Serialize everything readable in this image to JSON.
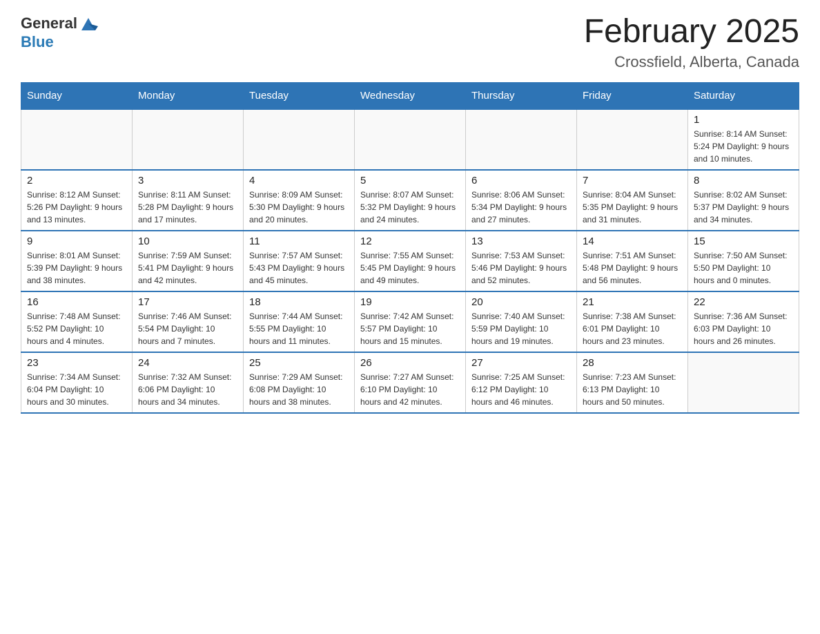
{
  "header": {
    "logo_general": "General",
    "logo_blue": "Blue",
    "month_title": "February 2025",
    "location": "Crossfield, Alberta, Canada"
  },
  "days_of_week": [
    "Sunday",
    "Monday",
    "Tuesday",
    "Wednesday",
    "Thursday",
    "Friday",
    "Saturday"
  ],
  "weeks": [
    [
      {
        "day": "",
        "info": ""
      },
      {
        "day": "",
        "info": ""
      },
      {
        "day": "",
        "info": ""
      },
      {
        "day": "",
        "info": ""
      },
      {
        "day": "",
        "info": ""
      },
      {
        "day": "",
        "info": ""
      },
      {
        "day": "1",
        "info": "Sunrise: 8:14 AM\nSunset: 5:24 PM\nDaylight: 9 hours and 10 minutes."
      }
    ],
    [
      {
        "day": "2",
        "info": "Sunrise: 8:12 AM\nSunset: 5:26 PM\nDaylight: 9 hours and 13 minutes."
      },
      {
        "day": "3",
        "info": "Sunrise: 8:11 AM\nSunset: 5:28 PM\nDaylight: 9 hours and 17 minutes."
      },
      {
        "day": "4",
        "info": "Sunrise: 8:09 AM\nSunset: 5:30 PM\nDaylight: 9 hours and 20 minutes."
      },
      {
        "day": "5",
        "info": "Sunrise: 8:07 AM\nSunset: 5:32 PM\nDaylight: 9 hours and 24 minutes."
      },
      {
        "day": "6",
        "info": "Sunrise: 8:06 AM\nSunset: 5:34 PM\nDaylight: 9 hours and 27 minutes."
      },
      {
        "day": "7",
        "info": "Sunrise: 8:04 AM\nSunset: 5:35 PM\nDaylight: 9 hours and 31 minutes."
      },
      {
        "day": "8",
        "info": "Sunrise: 8:02 AM\nSunset: 5:37 PM\nDaylight: 9 hours and 34 minutes."
      }
    ],
    [
      {
        "day": "9",
        "info": "Sunrise: 8:01 AM\nSunset: 5:39 PM\nDaylight: 9 hours and 38 minutes."
      },
      {
        "day": "10",
        "info": "Sunrise: 7:59 AM\nSunset: 5:41 PM\nDaylight: 9 hours and 42 minutes."
      },
      {
        "day": "11",
        "info": "Sunrise: 7:57 AM\nSunset: 5:43 PM\nDaylight: 9 hours and 45 minutes."
      },
      {
        "day": "12",
        "info": "Sunrise: 7:55 AM\nSunset: 5:45 PM\nDaylight: 9 hours and 49 minutes."
      },
      {
        "day": "13",
        "info": "Sunrise: 7:53 AM\nSunset: 5:46 PM\nDaylight: 9 hours and 52 minutes."
      },
      {
        "day": "14",
        "info": "Sunrise: 7:51 AM\nSunset: 5:48 PM\nDaylight: 9 hours and 56 minutes."
      },
      {
        "day": "15",
        "info": "Sunrise: 7:50 AM\nSunset: 5:50 PM\nDaylight: 10 hours and 0 minutes."
      }
    ],
    [
      {
        "day": "16",
        "info": "Sunrise: 7:48 AM\nSunset: 5:52 PM\nDaylight: 10 hours and 4 minutes."
      },
      {
        "day": "17",
        "info": "Sunrise: 7:46 AM\nSunset: 5:54 PM\nDaylight: 10 hours and 7 minutes."
      },
      {
        "day": "18",
        "info": "Sunrise: 7:44 AM\nSunset: 5:55 PM\nDaylight: 10 hours and 11 minutes."
      },
      {
        "day": "19",
        "info": "Sunrise: 7:42 AM\nSunset: 5:57 PM\nDaylight: 10 hours and 15 minutes."
      },
      {
        "day": "20",
        "info": "Sunrise: 7:40 AM\nSunset: 5:59 PM\nDaylight: 10 hours and 19 minutes."
      },
      {
        "day": "21",
        "info": "Sunrise: 7:38 AM\nSunset: 6:01 PM\nDaylight: 10 hours and 23 minutes."
      },
      {
        "day": "22",
        "info": "Sunrise: 7:36 AM\nSunset: 6:03 PM\nDaylight: 10 hours and 26 minutes."
      }
    ],
    [
      {
        "day": "23",
        "info": "Sunrise: 7:34 AM\nSunset: 6:04 PM\nDaylight: 10 hours and 30 minutes."
      },
      {
        "day": "24",
        "info": "Sunrise: 7:32 AM\nSunset: 6:06 PM\nDaylight: 10 hours and 34 minutes."
      },
      {
        "day": "25",
        "info": "Sunrise: 7:29 AM\nSunset: 6:08 PM\nDaylight: 10 hours and 38 minutes."
      },
      {
        "day": "26",
        "info": "Sunrise: 7:27 AM\nSunset: 6:10 PM\nDaylight: 10 hours and 42 minutes."
      },
      {
        "day": "27",
        "info": "Sunrise: 7:25 AM\nSunset: 6:12 PM\nDaylight: 10 hours and 46 minutes."
      },
      {
        "day": "28",
        "info": "Sunrise: 7:23 AM\nSunset: 6:13 PM\nDaylight: 10 hours and 50 minutes."
      },
      {
        "day": "",
        "info": ""
      }
    ]
  ]
}
